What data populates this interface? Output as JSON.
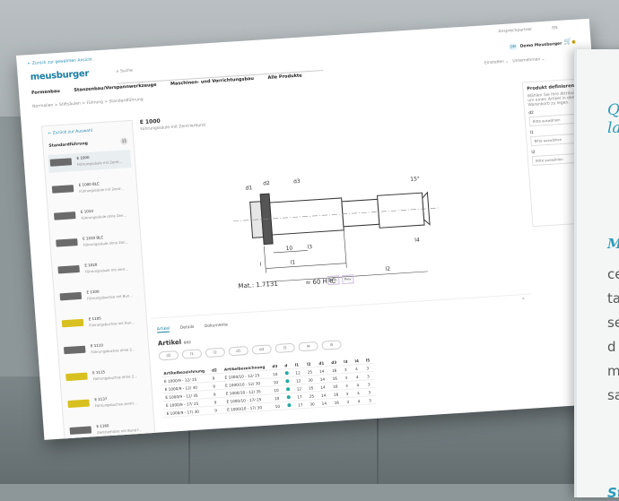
{
  "header": {
    "back_link": "← Zurück zur gewählten Ansicht",
    "logo": "meusburger",
    "search_placeholder": "Suche",
    "top_right_label": "Ansprechpartner",
    "lang": "EN",
    "user_initials": "DM",
    "user_name": "Demo Meusburger",
    "cart_count": "0",
    "menu_right": [
      "Einstellen",
      "Unternehmen"
    ]
  },
  "nav": [
    "Formenbau",
    "Stanzenbau/Vorspannwerkzeuge",
    "Maschinen- und Vorrichtungsbau",
    "Alle Produkte"
  ],
  "breadcrumb": [
    "Normalien",
    "Stiftsäulen",
    "Führung",
    "Standardführung"
  ],
  "sidebar": {
    "back": "← Zurück zur Auswahl",
    "heading": "Standardführung",
    "count": "11",
    "items": [
      {
        "code": "E 1000",
        "desc": "Führungssäule mit Zentr…",
        "color": "gray"
      },
      {
        "code": "E 1000 BLC",
        "desc": "Führungssäule mit Zentr…",
        "color": "gray"
      },
      {
        "code": "E 1010",
        "desc": "Führungssäule ohne Zen…",
        "color": "gray"
      },
      {
        "code": "E 1010 BLC",
        "desc": "Führungssäule ohne Zen…",
        "color": "gray"
      },
      {
        "code": "E 1020",
        "desc": "Führungssäule mit zent…",
        "color": "gray"
      },
      {
        "code": "E 1100",
        "desc": "Führungsbuchse mit Bun…",
        "color": "gray"
      },
      {
        "code": "E 1105",
        "desc": "Führungsbuchse mit Bun…",
        "color": "yellow"
      },
      {
        "code": "E 1110",
        "desc": "Führungsbuchse ohne Z…",
        "color": "gray"
      },
      {
        "code": "E 1115",
        "desc": "Führungsbuchse ohne Z…",
        "color": "yellow"
      },
      {
        "code": "E 1137",
        "desc": "Führungsbuchse zentri…",
        "color": "yellow"
      },
      {
        "code": "E 1160",
        "desc": "Zentrierhülse mit Bund f…",
        "color": "gray"
      }
    ]
  },
  "product": {
    "code": "E 1000",
    "desc": "Führungssäule mit Zentrierbund",
    "material": "Mat.: 1.7131",
    "hardness": "≈ 60 HRC",
    "dim_labels": [
      "d1",
      "d2",
      "d3",
      "l",
      "l1",
      "l2",
      "l3",
      "l4",
      "10",
      "15°"
    ]
  },
  "pager": [
    "Ansi",
    "Prev"
  ],
  "tabs": [
    "Artikel",
    "Details",
    "Dokumente"
  ],
  "article": {
    "title": "Artikel",
    "count": "882",
    "filters": [
      "d2",
      "l1",
      "l2",
      "d1",
      "d3",
      "l3",
      "l4",
      "l5"
    ],
    "left_columns": [
      "Artikelbezeichnung",
      "d2"
    ],
    "left_rows": [
      [
        "E 1000/9 - 12/ 25",
        "9"
      ],
      [
        "E 1000/9 - 12/ 30",
        "9"
      ],
      [
        "E 1000/9 - 12/ 35",
        "9"
      ],
      [
        "E 1000/9 - 17/ 25",
        "9"
      ],
      [
        "E 1000/9 - 17/ 30",
        "9"
      ]
    ],
    "mid_columns": [
      "Artikelbezeichnung",
      "d3",
      "d"
    ],
    "mid_rows": [
      [
        "E 1000/10 - 12/ 25",
        "10"
      ],
      [
        "E 1000/10 - 12/ 30",
        "10"
      ],
      [
        "E 1000/10 - 12/ 35",
        "10"
      ],
      [
        "E 1000/10 - 17/ 25",
        "10"
      ],
      [
        "E 1000/10 - 17/ 30",
        "10"
      ]
    ],
    "right_columns": [
      "l1",
      "l2",
      "d1",
      "d3",
      "l3",
      "l4",
      "l5"
    ],
    "right_rows": [
      [
        "12",
        "25",
        "14",
        "16",
        "3",
        "4",
        "3"
      ],
      [
        "12",
        "30",
        "14",
        "16",
        "3",
        "4",
        "3"
      ],
      [
        "12",
        "35",
        "14",
        "16",
        "3",
        "4",
        "3"
      ],
      [
        "17",
        "25",
        "14",
        "16",
        "3",
        "4",
        "3"
      ],
      [
        "17",
        "30",
        "14",
        "16",
        "3",
        "4",
        "3"
      ]
    ]
  },
  "define_panel": {
    "title": "Produkt definieren",
    "hint": "Wählen Sie Ihre Attribute aus, um einen Artikel in den Warenkorb zu legen.",
    "fields": [
      {
        "label": "d2",
        "placeholder": "Bitte auswählen"
      },
      {
        "label": "l1",
        "placeholder": "Bitte auswählen"
      },
      {
        "label": "l2",
        "placeholder": "Bitte auswählen"
      }
    ]
  },
  "card": {
    "heading": "Q\nla",
    "subheading": "M",
    "lines": [
      "ce",
      "ta",
      "se",
      "d",
      "m",
      "sa"
    ],
    "footer": "St"
  }
}
